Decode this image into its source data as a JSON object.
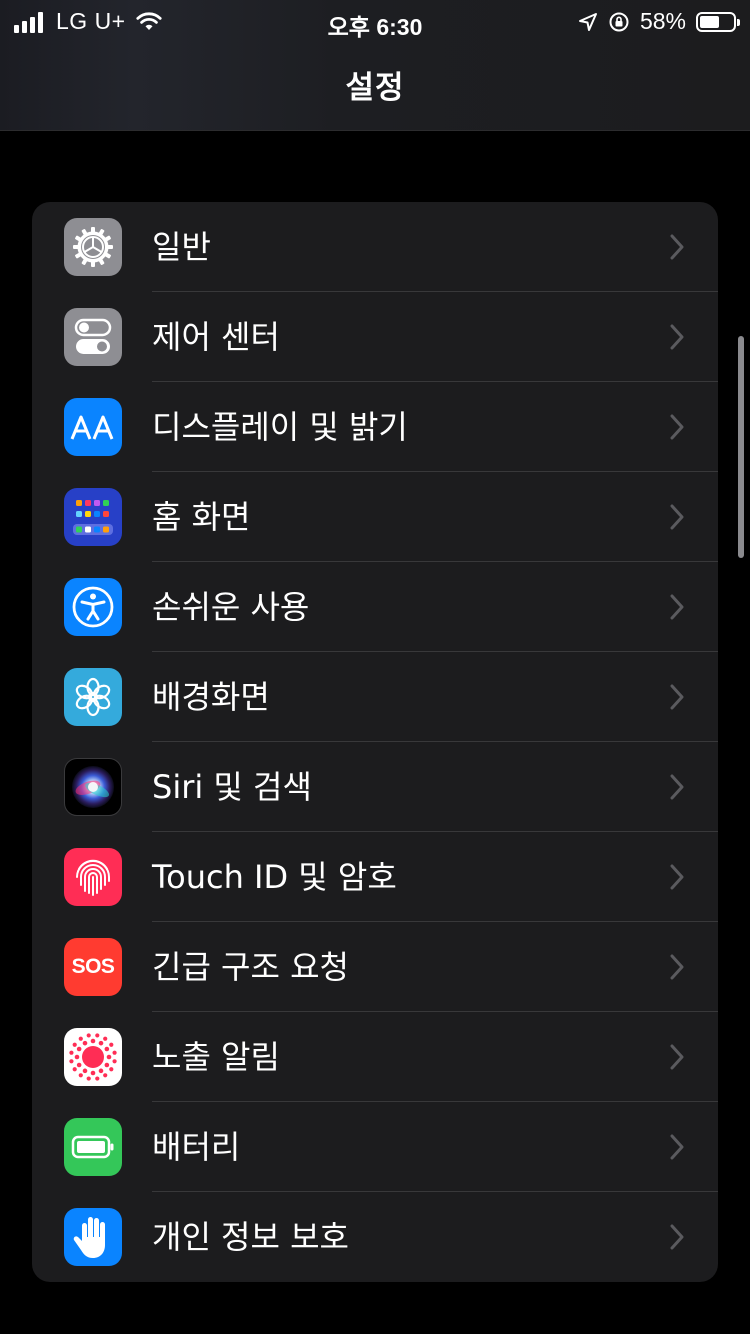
{
  "status_bar": {
    "carrier": "LG U+",
    "time": "오후 6:30",
    "battery_percent": "58%",
    "battery_level": 0.58
  },
  "header": {
    "title": "설정"
  },
  "settings": [
    {
      "label": "일반",
      "icon": "gear-icon",
      "color": "#8e8e93"
    },
    {
      "label": "제어 센터",
      "icon": "toggles-icon",
      "color": "#8e8e93"
    },
    {
      "label": "디스플레이 및 밝기",
      "icon": "display-aa-icon",
      "color": "#0a84ff"
    },
    {
      "label": "홈 화면",
      "icon": "home-screen-grid-icon",
      "color": "#2740c7"
    },
    {
      "label": "손쉬운 사용",
      "icon": "accessibility-icon",
      "color": "#0a84ff"
    },
    {
      "label": "배경화면",
      "icon": "wallpaper-flower-icon",
      "color": "#34aadc"
    },
    {
      "label": "Siri 및 검색",
      "icon": "siri-icon",
      "color": "#000000"
    },
    {
      "label": "Touch ID 및 암호",
      "icon": "fingerprint-icon",
      "color": "#ff2d55"
    },
    {
      "label": "긴급 구조 요청",
      "icon": "sos-icon",
      "color": "#ff3b30",
      "icon_text": "SOS"
    },
    {
      "label": "노출 알림",
      "icon": "exposure-notification-icon",
      "color": "#ffffff"
    },
    {
      "label": "배터리",
      "icon": "battery-icon",
      "color": "#34c759"
    },
    {
      "label": "개인 정보 보호",
      "icon": "privacy-hand-icon",
      "color": "#0a84ff"
    }
  ]
}
